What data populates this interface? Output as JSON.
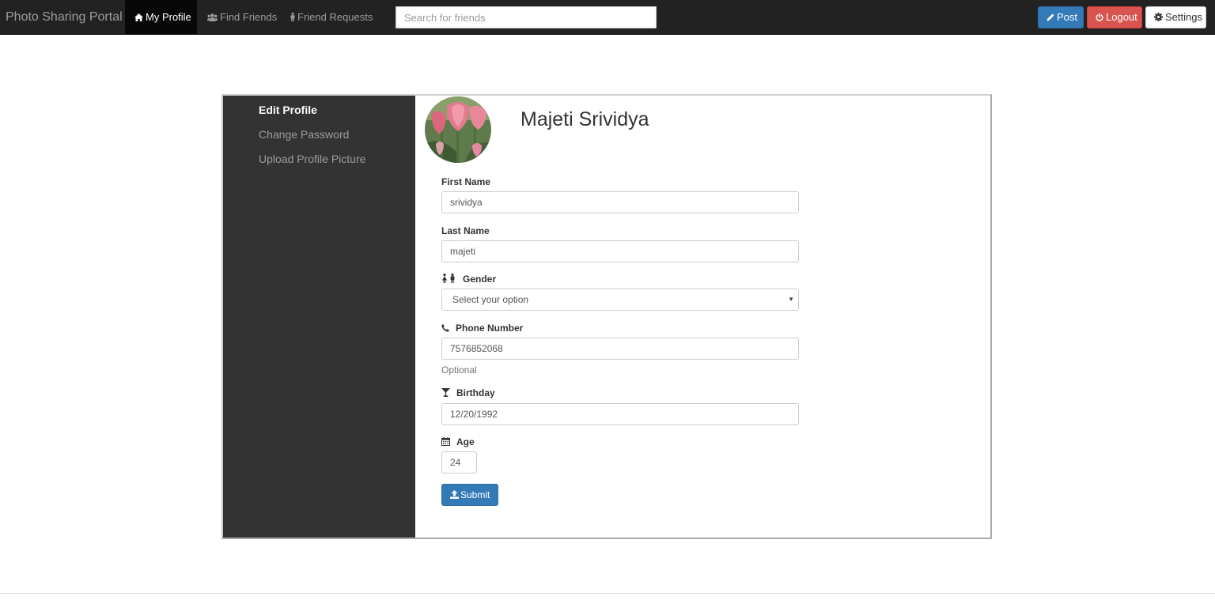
{
  "navbar": {
    "brand": "Photo Sharing Portal",
    "items": [
      {
        "label": "My Profile",
        "icon": "home-icon",
        "active": true
      },
      {
        "label": "Find Friends",
        "icon": "users-icon",
        "active": false
      },
      {
        "label": "Friend Requests",
        "icon": "person-icon",
        "active": false
      }
    ],
    "search_placeholder": "Search for friends",
    "post_label": "Post",
    "logout_label": "Logout",
    "settings_label": "Settings"
  },
  "sidebar": {
    "items": [
      {
        "label": "Edit Profile",
        "active": true
      },
      {
        "label": "Change Password",
        "active": false
      },
      {
        "label": "Upload Profile Picture",
        "active": false
      }
    ]
  },
  "profile": {
    "name": "Majeti Srividya",
    "avatar_icon": "tulip-photo"
  },
  "form": {
    "first_name_label": "First Name",
    "first_name_value": "srividya",
    "last_name_label": "Last Name",
    "last_name_value": "majeti",
    "gender_label": "Gender",
    "gender_selected": "Select your option",
    "phone_label": "Phone Number",
    "phone_value": "7576852068",
    "phone_help": "Optional",
    "birthday_label": "Birthday",
    "birthday_value": "12/20/1992",
    "age_label": "Age",
    "age_value": "24",
    "submit_label": "Submit"
  },
  "colors": {
    "navbar_bg": "#222222",
    "sidebar_bg": "#333333",
    "primary": "#337ab7",
    "danger": "#d9534f"
  }
}
